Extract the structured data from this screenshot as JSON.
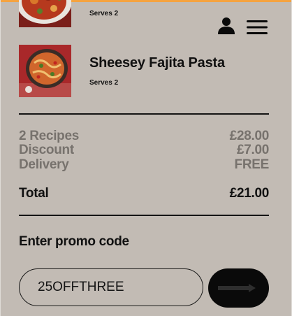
{
  "header": {
    "account_icon": "person-icon",
    "menu_icon": "hamburger-menu-icon"
  },
  "recipes": [
    {
      "name": "",
      "serves": "Serves 2",
      "thumb_icon": "recipe-photo"
    },
    {
      "name": "Sheesey Fajita Pasta",
      "serves": "Serves 2",
      "thumb_icon": "recipe-photo"
    }
  ],
  "summary": {
    "recipes_label": "2 Recipes",
    "recipes_value": "£28.00",
    "discount_label": "Discount",
    "discount_value": "£7.00",
    "delivery_label": "Delivery",
    "delivery_value": "FREE",
    "total_label": "Total",
    "total_value": "£21.00"
  },
  "promo": {
    "heading": "Enter promo code",
    "value": "25OFFTHREE",
    "apply_icon": "arrow-right-icon"
  },
  "colors": {
    "background": "#c2bbb4",
    "accent": "#f5a340",
    "muted_text": "#77726d",
    "dark": "#0a0a0a"
  }
}
